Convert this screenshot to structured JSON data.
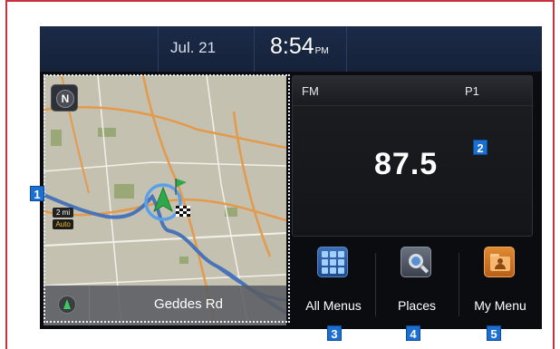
{
  "status_bar": {
    "date": "Jul. 21",
    "time": "8:54",
    "ampm": "PM"
  },
  "map": {
    "compass_label": "N",
    "scale_distance": "2 mi",
    "scale_mode": "Auto",
    "road_name": "Geddes Rd"
  },
  "radio": {
    "band": "FM",
    "preset": "P1",
    "frequency": "87.5"
  },
  "menus": [
    {
      "label": "All Menus",
      "icon": "grid-icon"
    },
    {
      "label": "Places",
      "icon": "search-icon"
    },
    {
      "label": "My Menu",
      "icon": "folder-user-icon"
    }
  ],
  "callouts": [
    "1",
    "2",
    "3",
    "4",
    "5"
  ],
  "colors": {
    "callout_blue": "#1a6fd0",
    "frame_red": "#c8323c",
    "status_bar": "#1b2a47"
  }
}
